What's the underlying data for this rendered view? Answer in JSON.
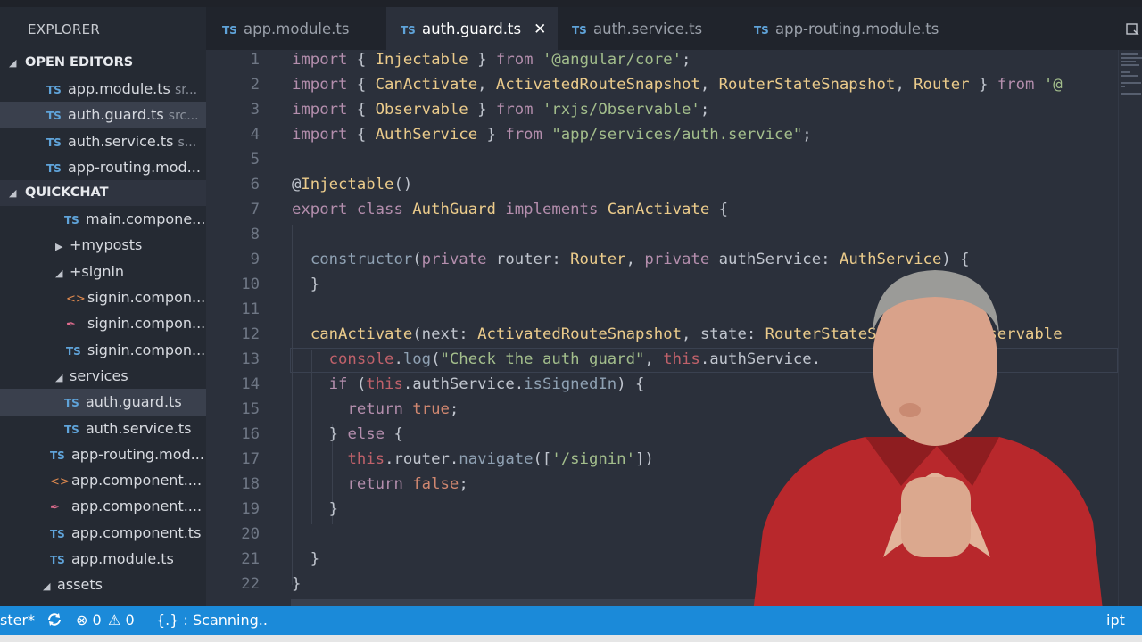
{
  "explorer": {
    "title": "EXPLORER",
    "open_editors_label": "OPEN EDITORS",
    "open_editors": [
      {
        "name": "app.module.ts",
        "path": "sr..."
      },
      {
        "name": "auth.guard.ts",
        "path": "src..."
      },
      {
        "name": "auth.service.ts",
        "path": "s..."
      },
      {
        "name": "app-routing.mod...",
        "path": ""
      }
    ],
    "project_label": "QUICKCHAT",
    "tree": [
      {
        "label": "main.compone...",
        "icon": "ts"
      },
      {
        "label": "+myposts",
        "icon": "folder-collapsed"
      },
      {
        "label": "+signin",
        "icon": "folder-expanded"
      },
      {
        "label": "signin.compon...",
        "icon": "html"
      },
      {
        "label": "signin.compon...",
        "icon": "css"
      },
      {
        "label": "signin.compon...",
        "icon": "ts"
      },
      {
        "label": "services",
        "icon": "folder-expanded"
      },
      {
        "label": "auth.guard.ts",
        "icon": "ts"
      },
      {
        "label": "auth.service.ts",
        "icon": "ts"
      },
      {
        "label": "app-routing.mod...",
        "icon": "ts"
      },
      {
        "label": "app.component....",
        "icon": "html"
      },
      {
        "label": "app.component....",
        "icon": "css"
      },
      {
        "label": "app.component.ts",
        "icon": "ts"
      },
      {
        "label": "app.module.ts",
        "icon": "ts"
      },
      {
        "label": "assets",
        "icon": "folder-expanded"
      }
    ]
  },
  "tabs": [
    {
      "label": "app.module.ts"
    },
    {
      "label": "auth.guard.ts",
      "close": "✕"
    },
    {
      "label": "auth.service.ts"
    },
    {
      "label": "app-routing.module.ts"
    }
  ],
  "ts_badge": "TS",
  "editor": {
    "line_numbers": [
      "1",
      "2",
      "3",
      "4",
      "5",
      "6",
      "7",
      "8",
      "9",
      "10",
      "11",
      "12",
      "13",
      "14",
      "15",
      "16",
      "17",
      "18",
      "19",
      "20",
      "21",
      "22"
    ]
  },
  "status": {
    "branch": "ster*",
    "errors": "0",
    "warnings": "0",
    "scanning": "{.} : Scanning..",
    "language": "ipt"
  },
  "colors": {
    "editor_bg": "#2b303b",
    "sidebar_bg": "#252a33",
    "statusbar_bg": "#1b8ad9",
    "keyword": "#b48ead",
    "string": "#a3be8c",
    "type": "#ebcb8b",
    "function": "#8fa1b3"
  }
}
